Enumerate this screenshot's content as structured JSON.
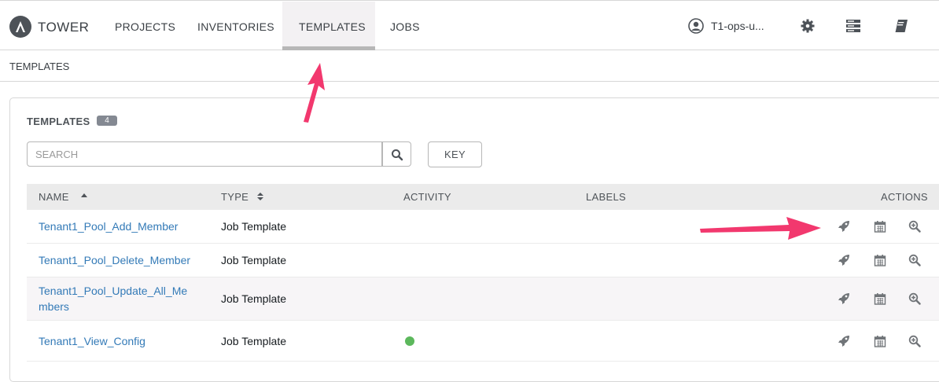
{
  "nav": {
    "brand": "TOWER",
    "items": [
      "PROJECTS",
      "INVENTORIES",
      "TEMPLATES",
      "JOBS"
    ],
    "active": "TEMPLATES",
    "user": "T1-ops-u..."
  },
  "breadcrumb": "TEMPLATES",
  "panel": {
    "title": "TEMPLATES",
    "count": "4",
    "search_placeholder": "SEARCH",
    "key_label": "KEY"
  },
  "table": {
    "columns": [
      "NAME",
      "TYPE",
      "ACTIVITY",
      "LABELS",
      "ACTIONS"
    ],
    "rows": [
      {
        "name": "Tenant1_Pool_Add_Member",
        "type": "Job Template",
        "activity": ""
      },
      {
        "name": "Tenant1_Pool_Delete_Member",
        "type": "Job Template",
        "activity": ""
      },
      {
        "name": "Tenant1_Pool_Update_All_Members",
        "type": "Job Template",
        "activity": ""
      },
      {
        "name": "Tenant1_View_Config",
        "type": "Job Template",
        "activity": "success"
      }
    ]
  },
  "colors": {
    "link": "#337ab7",
    "annotation_arrow": "#f2386e",
    "success": "#5cb85c"
  },
  "icons": [
    "ansible-logo-icon",
    "user-icon",
    "gear-icon",
    "server-icon",
    "book-icon",
    "search-icon",
    "rocket-icon",
    "calendar-icon",
    "zoom-icon"
  ]
}
